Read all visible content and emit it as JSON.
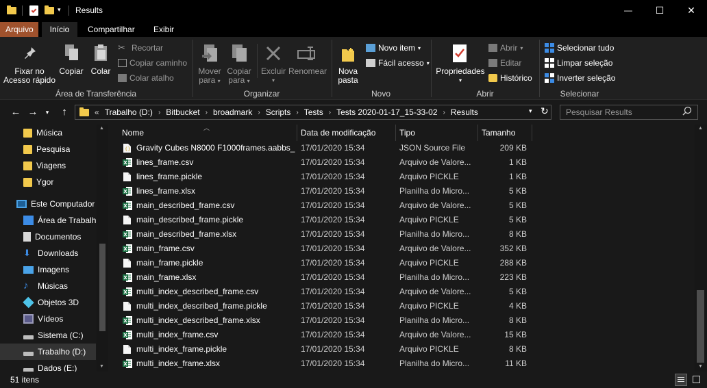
{
  "window": {
    "title": "Results",
    "minimize": "—",
    "maximize": "☐",
    "close": "✕"
  },
  "tabs": {
    "file": "Arquivo",
    "home": "Início",
    "share": "Compartilhar",
    "view": "Exibir"
  },
  "ribbon": {
    "pin": [
      "Fixar no",
      "Acesso rápido"
    ],
    "copy": "Copiar",
    "paste": "Colar",
    "cut": "Recortar",
    "copy_path": "Copiar caminho",
    "paste_shortcut": "Colar atalho",
    "clipboard_group": "Área de Transferência",
    "move_to": [
      "Mover",
      "para"
    ],
    "copy_to": [
      "Copiar",
      "para"
    ],
    "delete": "Excluir",
    "rename": "Renomear",
    "organize_group": "Organizar",
    "new_folder": [
      "Nova",
      "pasta"
    ],
    "new_item": "Novo item",
    "easy_access": "Fácil acesso",
    "new_group": "Novo",
    "properties": "Propriedades",
    "open": "Abrir",
    "edit": "Editar",
    "history": "Histórico",
    "open_group": "Abrir",
    "select_all": "Selecionar tudo",
    "select_none": "Limpar seleção",
    "invert_selection": "Inverter seleção",
    "select_group": "Selecionar"
  },
  "address": {
    "prefix": "«",
    "crumbs": [
      "Trabalho (D:)",
      "Bitbucket",
      "broadmark",
      "Scripts",
      "Tests",
      "Tests 2020-01-17_15-33-02",
      "Results"
    ],
    "search_placeholder": "Pesquisar Results"
  },
  "nav": {
    "items": [
      {
        "label": "Música",
        "icon": "folder-icon"
      },
      {
        "label": "Pesquisa",
        "icon": "folder-icon"
      },
      {
        "label": "Viagens",
        "icon": "folder-icon"
      },
      {
        "label": "Ygor",
        "icon": "folder-icon"
      },
      {
        "label": "Este Computador",
        "icon": "computer-icon"
      },
      {
        "label": "Área de Trabalho",
        "icon": "desktop-icon"
      },
      {
        "label": "Documentos",
        "icon": "documents-icon"
      },
      {
        "label": "Downloads",
        "icon": "downloads-icon"
      },
      {
        "label": "Imagens",
        "icon": "pictures-icon"
      },
      {
        "label": "Músicas",
        "icon": "music-icon"
      },
      {
        "label": "Objetos 3D",
        "icon": "3d-objects-icon"
      },
      {
        "label": "Vídeos",
        "icon": "videos-icon"
      },
      {
        "label": "Sistema (C:)",
        "icon": "drive-icon"
      },
      {
        "label": "Trabalho (D:)",
        "icon": "drive-icon"
      },
      {
        "label": "Dados (E:)",
        "icon": "drive-icon"
      }
    ]
  },
  "columns": {
    "name": "Nome",
    "modified": "Data de modificação",
    "type": "Tipo",
    "size": "Tamanho"
  },
  "files": [
    {
      "name": "Gravity Cubes N8000 F1000frames.aabbs_...",
      "modified": "17/01/2020 15:34",
      "type": "JSON Source File",
      "size": "209 KB",
      "icon": "json-file-icon"
    },
    {
      "name": "lines_frame.csv",
      "modified": "17/01/2020 15:34",
      "type": "Arquivo de Valore...",
      "size": "1 KB",
      "icon": "excel-file-icon"
    },
    {
      "name": "lines_frame.pickle",
      "modified": "17/01/2020 15:34",
      "type": "Arquivo PICKLE",
      "size": "1 KB",
      "icon": "blank-file-icon"
    },
    {
      "name": "lines_frame.xlsx",
      "modified": "17/01/2020 15:34",
      "type": "Planilha do Micro...",
      "size": "5 KB",
      "icon": "excel-file-icon"
    },
    {
      "name": "main_described_frame.csv",
      "modified": "17/01/2020 15:34",
      "type": "Arquivo de Valore...",
      "size": "5 KB",
      "icon": "excel-file-icon"
    },
    {
      "name": "main_described_frame.pickle",
      "modified": "17/01/2020 15:34",
      "type": "Arquivo PICKLE",
      "size": "5 KB",
      "icon": "blank-file-icon"
    },
    {
      "name": "main_described_frame.xlsx",
      "modified": "17/01/2020 15:34",
      "type": "Planilha do Micro...",
      "size": "8 KB",
      "icon": "excel-file-icon"
    },
    {
      "name": "main_frame.csv",
      "modified": "17/01/2020 15:34",
      "type": "Arquivo de Valore...",
      "size": "352 KB",
      "icon": "excel-file-icon"
    },
    {
      "name": "main_frame.pickle",
      "modified": "17/01/2020 15:34",
      "type": "Arquivo PICKLE",
      "size": "288 KB",
      "icon": "blank-file-icon"
    },
    {
      "name": "main_frame.xlsx",
      "modified": "17/01/2020 15:34",
      "type": "Planilha do Micro...",
      "size": "223 KB",
      "icon": "excel-file-icon"
    },
    {
      "name": "multi_index_described_frame.csv",
      "modified": "17/01/2020 15:34",
      "type": "Arquivo de Valore...",
      "size": "5 KB",
      "icon": "excel-file-icon"
    },
    {
      "name": "multi_index_described_frame.pickle",
      "modified": "17/01/2020 15:34",
      "type": "Arquivo PICKLE",
      "size": "4 KB",
      "icon": "blank-file-icon"
    },
    {
      "name": "multi_index_described_frame.xlsx",
      "modified": "17/01/2020 15:34",
      "type": "Planilha do Micro...",
      "size": "8 KB",
      "icon": "excel-file-icon"
    },
    {
      "name": "multi_index_frame.csv",
      "modified": "17/01/2020 15:34",
      "type": "Arquivo de Valore...",
      "size": "15 KB",
      "icon": "excel-file-icon"
    },
    {
      "name": "multi_index_frame.pickle",
      "modified": "17/01/2020 15:34",
      "type": "Arquivo PICKLE",
      "size": "8 KB",
      "icon": "blank-file-icon"
    },
    {
      "name": "multi_index_frame.xlsx",
      "modified": "17/01/2020 15:34",
      "type": "Planilha do Micro...",
      "size": "11 KB",
      "icon": "excel-file-icon"
    }
  ],
  "status": {
    "count": "51 itens"
  },
  "colors": {
    "file_tab": "#a0522d",
    "folder": "#f2c94c",
    "excel": "#1e7145",
    "accent": "#3c8ce6"
  }
}
